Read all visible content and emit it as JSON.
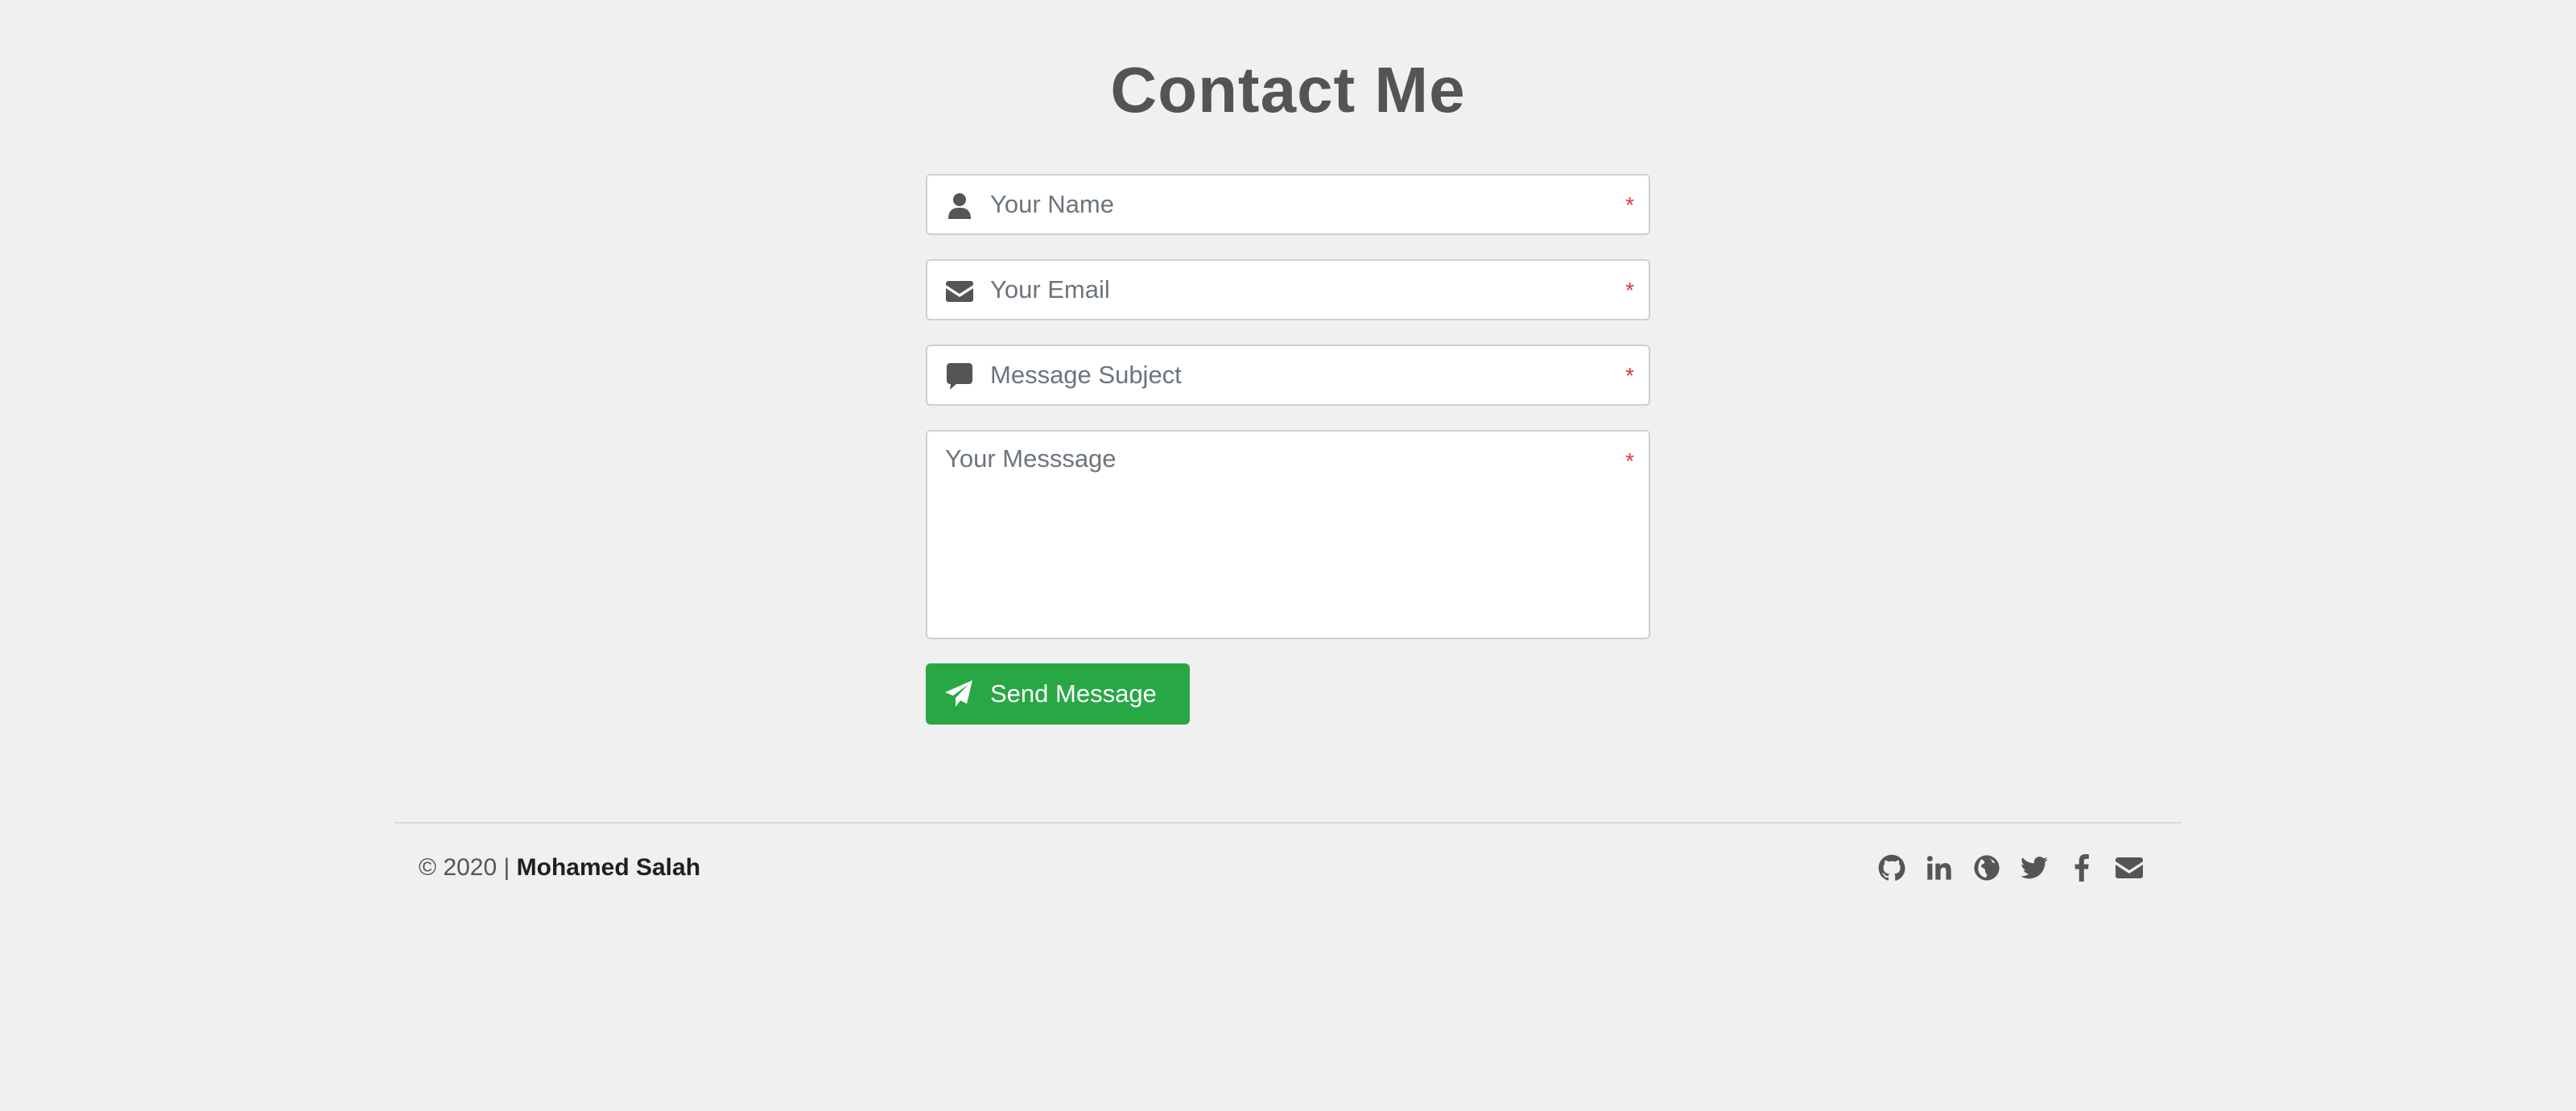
{
  "page": {
    "title": "Contact Me"
  },
  "form": {
    "name": {
      "icon": "user-icon",
      "placeholder": "Your Name",
      "value": "",
      "required_mark": "*"
    },
    "email": {
      "icon": "envelope-icon",
      "placeholder": "Your Email",
      "value": "",
      "required_mark": "*"
    },
    "subject": {
      "icon": "comment-icon",
      "placeholder": "Message Subject",
      "value": "",
      "required_mark": "*"
    },
    "message": {
      "placeholder": "Your Messsage",
      "value": "",
      "required_mark": "*"
    },
    "submit": {
      "icon": "paper-plane-icon",
      "label": "Send Message"
    }
  },
  "footer": {
    "copyright_prefix": "© 2020 | ",
    "author": "Mohamed Salah",
    "social_links": [
      {
        "icon": "github-icon"
      },
      {
        "icon": "linkedin-icon"
      },
      {
        "icon": "globe-icon"
      },
      {
        "icon": "twitter-icon"
      },
      {
        "icon": "facebook-icon"
      },
      {
        "icon": "envelope-icon"
      }
    ]
  },
  "colors": {
    "background": "#f0f0f0",
    "title": "#545454",
    "accent_button": "#28a745",
    "required": "#dc3545",
    "icon": "#555555"
  }
}
